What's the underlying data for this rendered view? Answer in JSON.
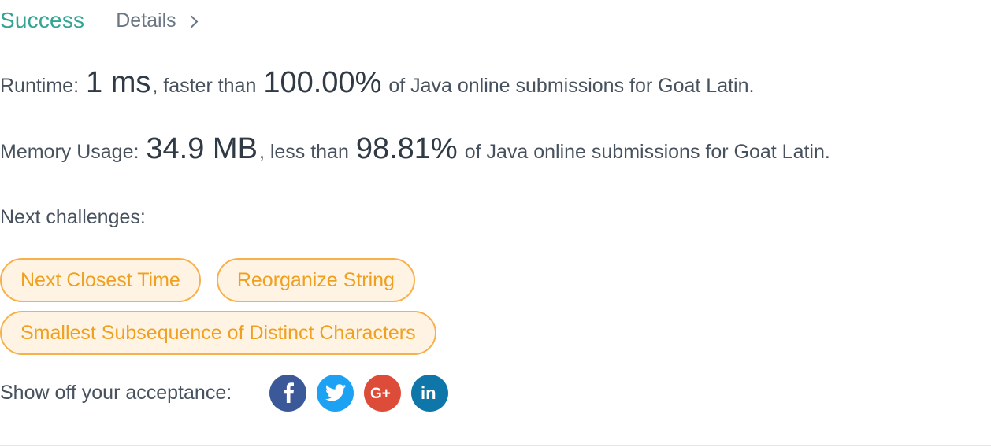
{
  "header": {
    "status": "Success",
    "details_label": "Details"
  },
  "runtime": {
    "label": "Runtime:",
    "value": "1 ms",
    "comparison": ", faster than",
    "percent": "100.00%",
    "suffix": "of Java online submissions for Goat Latin."
  },
  "memory": {
    "label": "Memory Usage:",
    "value": "34.9 MB",
    "comparison": ", less than",
    "percent": "98.81%",
    "suffix": "of Java online submissions for Goat Latin."
  },
  "next_challenges": {
    "label": "Next challenges:",
    "items": [
      "Next Closest Time",
      "Reorganize String",
      "Smallest Subsequence of Distinct Characters"
    ]
  },
  "share": {
    "label": "Show off your acceptance:",
    "networks": [
      {
        "name": "facebook-icon",
        "glyph": "f",
        "color": "#3b5998"
      },
      {
        "name": "twitter-icon",
        "glyph": "twitter",
        "color": "#1da1f2"
      },
      {
        "name": "google-plus-icon",
        "glyph": "G+",
        "color": "#dd4b39"
      },
      {
        "name": "linkedin-icon",
        "glyph": "in",
        "color": "#0e76a8"
      }
    ]
  },
  "colors": {
    "success": "#33a595",
    "chip_border": "#f7b04a",
    "chip_bg": "#fff4e3",
    "chip_text": "#f0a020"
  }
}
